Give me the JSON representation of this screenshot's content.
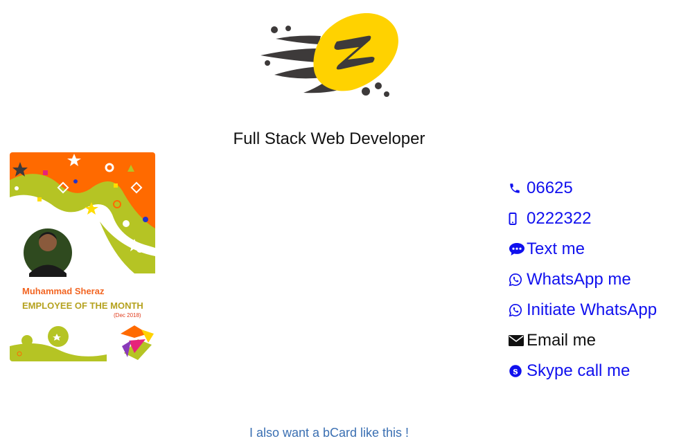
{
  "header": {
    "logo_icon": "z-brand-logo-icon",
    "headline": "Full Stack Web Developer"
  },
  "card": {
    "name": "Muhammad Sheraz",
    "award": "EMPLOYEE OF THE MONTH",
    "date": "(Dec 2018)",
    "colors": {
      "orange": "#ff6a00",
      "lime": "#b5c424",
      "name_orange": "#f26522"
    }
  },
  "contacts": {
    "phone": {
      "icon": "phone-icon",
      "label": "06625"
    },
    "mobile": {
      "icon": "mobile-icon",
      "label": "0222322"
    },
    "sms": {
      "icon": "chat-icon",
      "label": "Text me"
    },
    "whatsapp": {
      "icon": "whatsapp-icon",
      "label": "WhatsApp me"
    },
    "whatsapp_initiate": {
      "icon": "whatsapp-icon",
      "label": "Initiate WhatsApp"
    },
    "email": {
      "icon": "envelope-icon",
      "label": "Email me"
    },
    "skype": {
      "icon": "skype-icon",
      "label": "Skype call me"
    },
    "link_color": "#1010ee"
  },
  "footer": {
    "link": "I also want a bCard like this !",
    "color": "#3a6fb2"
  }
}
